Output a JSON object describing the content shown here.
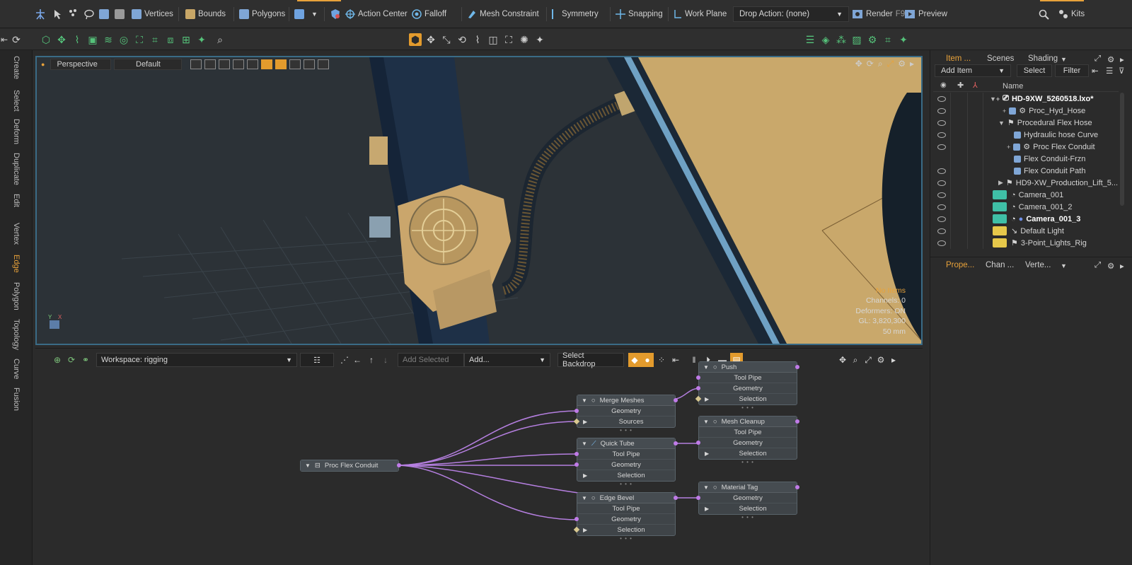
{
  "topbar": {
    "vertices": "Vertices",
    "bounds": "Bounds",
    "polygons": "Polygons",
    "action_center": "Action Center",
    "falloff": "Falloff",
    "mesh_constraint": "Mesh Constraint",
    "symmetry": "Symmetry",
    "snapping": "Snapping",
    "work_plane": "Work Plane",
    "drop_action": "Drop Action: (none)",
    "render": "Render",
    "render_key": "F9",
    "preview": "Preview",
    "kits": "Kits"
  },
  "left_tabs": [
    "Create",
    "Select",
    "Deform",
    "Duplicate",
    "Edit",
    "Vertex",
    "Edge",
    "Polygon",
    "Topology",
    "Curve",
    "Fusion"
  ],
  "viewport": {
    "view": "Perspective",
    "style": "Default",
    "info": {
      "items": "No Items",
      "channels": "Channels: 0",
      "deformers": "Deformers: ON",
      "gl": "GL: 3,820,300",
      "focal": "50 mm"
    }
  },
  "node_panel": {
    "workspace": "Workspace: rigging",
    "add_selected": "Add Selected",
    "add": "Add...",
    "select_backdrop": "Select Backdrop",
    "nodes": {
      "proc_flex": {
        "title": "Proc Flex Conduit"
      },
      "merge": {
        "title": "Merge Meshes",
        "rows": [
          "Geometry",
          "Sources"
        ]
      },
      "quick_tube": {
        "title": "Quick Tube",
        "rows": [
          "Tool Pipe",
          "Geometry",
          "Selection"
        ]
      },
      "edge_bevel": {
        "title": "Edge Bevel",
        "rows": [
          "Tool Pipe",
          "Geometry",
          "Selection"
        ]
      },
      "push": {
        "title": "Push",
        "rows": [
          "Tool Pipe",
          "Geometry",
          "Selection"
        ]
      },
      "mesh_cleanup": {
        "title": "Mesh Cleanup",
        "rows": [
          "Tool Pipe",
          "Geometry",
          "Selection"
        ]
      },
      "material_tag": {
        "title": "Material Tag",
        "rows": [
          "Geometry",
          "Selection"
        ]
      }
    }
  },
  "right_panel": {
    "tabs": {
      "items": "Item ...",
      "scenes": "Scenes",
      "shading": "Shading"
    },
    "add_item": "Add Item",
    "select": "Select",
    "filter": "Filter",
    "col_name": "Name",
    "tree": [
      {
        "label": "HD-9XW_5260518.lxo*"
      },
      {
        "label": "Proc_Hyd_Hose"
      },
      {
        "label": "Procedural Flex Hose"
      },
      {
        "label": "Hydraulic hose Curve"
      },
      {
        "label": "Proc Flex Conduit"
      },
      {
        "label": "Flex Conduit-Frzn"
      },
      {
        "label": "Flex Conduit Path"
      },
      {
        "label": "HD9-XW_Production_Lift_5..."
      },
      {
        "label": "Camera_001"
      },
      {
        "label": "Camera_001_2"
      },
      {
        "label": "Camera_001_3"
      },
      {
        "label": "Default Light"
      },
      {
        "label": "3-Point_Lights_Rig"
      }
    ],
    "props_tabs": {
      "properties": "Prope...",
      "channels": "Chan ...",
      "vertex": "Verte..."
    }
  },
  "colors": {
    "accent": "#e8a23a",
    "viewport_border": "#3a6b86",
    "wire": "#c07be8",
    "teal": "#3fbfa6"
  }
}
